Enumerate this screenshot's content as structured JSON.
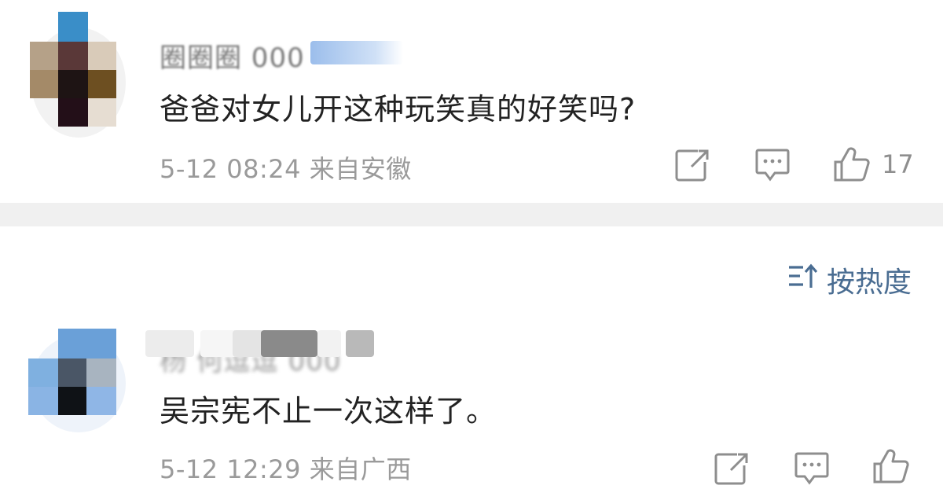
{
  "comments": [
    {
      "username": "圈圈圈 000",
      "text": "爸爸对女儿开这种玩笑真的好笑吗?",
      "meta": "5-12 08:24 来自安徽",
      "likes": "17"
    },
    {
      "username": "杨 何逗逗 000",
      "text": "吴宗宪不止一次这样了。",
      "meta": "5-12 12:29 来自广西",
      "likes": ""
    }
  ],
  "sort": {
    "label": "按热度"
  },
  "icons": {
    "share": "share-icon",
    "comment": "comment-icon",
    "like": "like-icon",
    "sort": "sort-icon"
  },
  "colors": {
    "meta_gray": "#9a9a9a",
    "sort_blue": "#4a6d92",
    "divider": "#f0f0f0"
  }
}
